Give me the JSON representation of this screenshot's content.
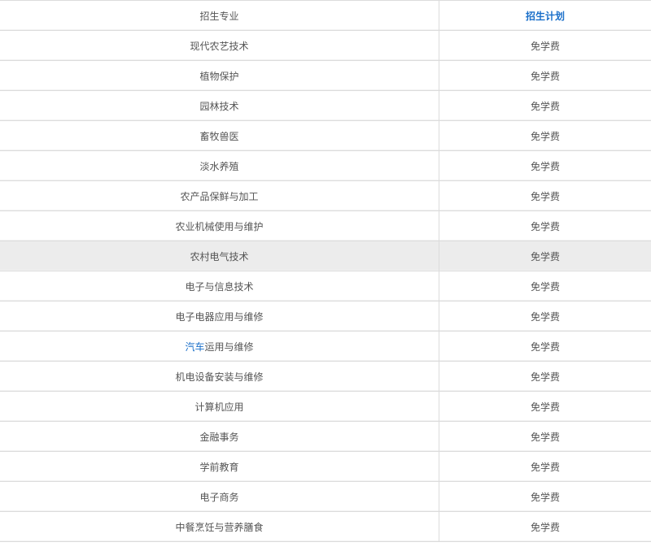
{
  "header": {
    "col1": "招生专业",
    "col2": "招生计划"
  },
  "rows": [
    {
      "major": "现代农艺技术",
      "plan": "免学费"
    },
    {
      "major": "植物保护",
      "plan": "免学费"
    },
    {
      "major": "园林技术",
      "plan": "免学费"
    },
    {
      "major": "畜牧兽医",
      "plan": "免学费"
    },
    {
      "major": "淡水养殖",
      "plan": "免学费"
    },
    {
      "major": "农产品保鲜与加工",
      "plan": "免学费"
    },
    {
      "major": "农业机械使用与维护",
      "plan": "免学费"
    },
    {
      "major": "农村电气技术",
      "plan": "免学费"
    },
    {
      "major": "电子与信息技术",
      "plan": "免学费"
    },
    {
      "major": "电子电器应用与维修",
      "plan": "免学费"
    },
    {
      "major_link": "汽车",
      "major_rest": "运用与维修",
      "plan": "免学费"
    },
    {
      "major": "机电设备安装与维修",
      "plan": "免学费"
    },
    {
      "major": "计算机应用",
      "plan": "免学费"
    },
    {
      "major": "金融事务",
      "plan": "免学费"
    },
    {
      "major": "学前教育",
      "plan": "免学费"
    },
    {
      "major": "电子商务",
      "plan": "免学费"
    },
    {
      "major": "中餐烹饪与营养膳食",
      "plan": "免学费"
    }
  ],
  "colors": {
    "link": "#1a6fc9",
    "highlight_row": "#ececec",
    "text": "#555555",
    "border": "#dcdcdc"
  }
}
